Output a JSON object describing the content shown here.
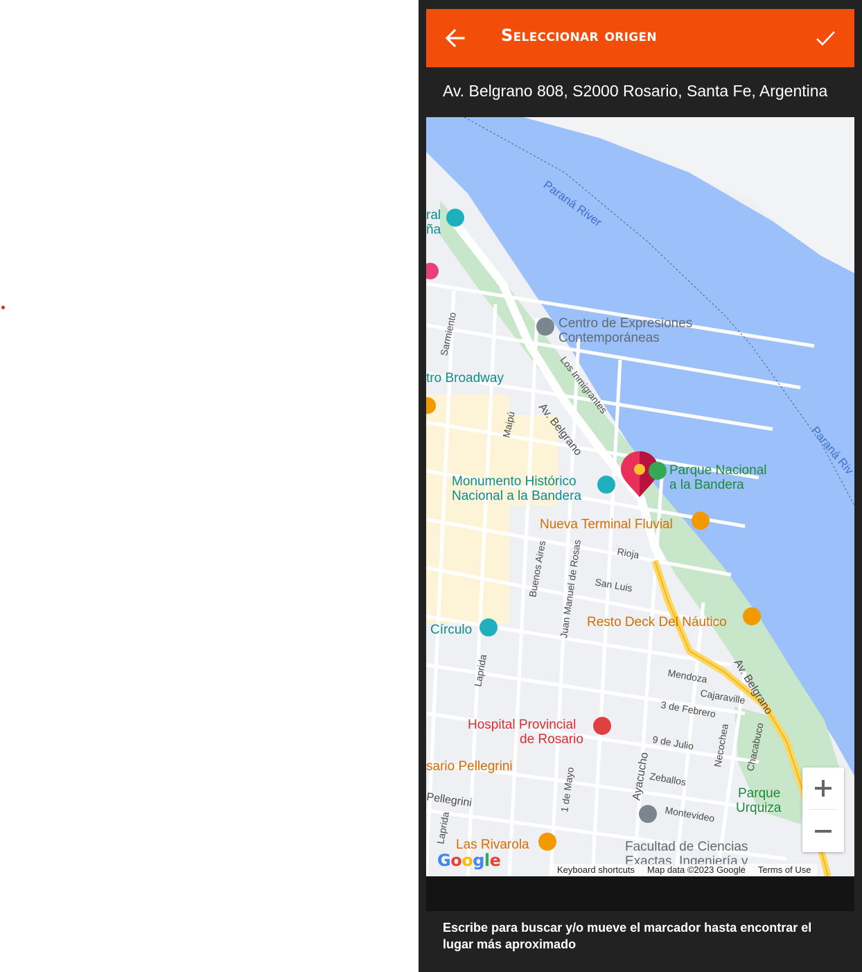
{
  "header": {
    "title": "Seleccionar origen",
    "back_icon": "arrow-left-icon",
    "confirm_icon": "checkmark-icon"
  },
  "address": {
    "value": "Av. Belgrano 808, S2000 Rosario, Santa Fe, Argentina"
  },
  "map": {
    "labels": {
      "river1": "Paraná River",
      "river2": "Paraná Riv",
      "centro1": "Centro de Expresiones",
      "centro2": "Contemporáneas",
      "broadway": "tro Broadway",
      "parque_bandera1": "Parque Nacional",
      "parque_bandera2": "a la Bandera",
      "monumento1": "Monumento Histórico",
      "monumento2": "Nacional a la Bandera",
      "terminal": "Nueva Terminal Fluvial",
      "resto": "Resto Deck Del Náutico",
      "circulo": "Círculo",
      "hospital1": "Hospital Provincial",
      "hospital2": "de Rosario",
      "pellegrini_place": "sario Pellegrini",
      "rivarola": "Las Rivarola",
      "facultad1": "Facultad de Ciencias",
      "facultad2": "Exactas, Ingeniería y",
      "parque_urquiza1": "Parque",
      "parque_urquiza2": "Urquiza",
      "partial1": "ral",
      "partial2": "ña",
      "street_sarmiento": "Sarmiento",
      "street_maipu": "Maipú",
      "street_belgrano1": "Av. Belgrano",
      "street_belgrano2": "Av. Belgrano",
      "street_inmigrantes": "Los Inmigrantes",
      "street_rioja": "Rioja",
      "street_sanluis": "San Luis",
      "street_buenosaires": "Buenos Aires",
      "street_juanmanuel": "Juan Manuel de Rosas",
      "street_laprida1": "Laprida",
      "street_laprida2": "Laprida",
      "street_mendoza": "Mendoza",
      "street_cajaraville": "Cajaraville",
      "street_3feb": "3 de Febrero",
      "street_9julio": "9 de Julio",
      "street_necochea": "Necochea",
      "street_chacabuco": "Chacabuco",
      "street_ayacucho": "Ayacucho",
      "street_zeballos": "Zeballos",
      "street_1mayo": "1 de Mayo",
      "street_pellegrini": "Pellegrini",
      "street_montevideo": "Montevideo"
    },
    "zoom_in_label": "+",
    "zoom_out_label": "−",
    "attribution": {
      "shortcuts": "Keyboard shortcuts",
      "mapdata": "Map data ©2023 Google",
      "terms": "Terms of Use"
    },
    "logo": {
      "g1": "G",
      "o1": "o",
      "o2": "o",
      "g2": "g",
      "l": "l",
      "e": "e"
    },
    "colors": {
      "water": "#9cc0f9",
      "park": "#c8e6c9",
      "road": "#ffffff",
      "highway": "#fdd663",
      "land": "#eef0f3",
      "pin": "#e8305a"
    }
  },
  "hint": {
    "text": "Escribe para buscar y/o mueve el marcador hasta encontrar el lugar más aproximado"
  },
  "colors": {
    "accent": "#f24e0a",
    "panel": "#222222"
  }
}
